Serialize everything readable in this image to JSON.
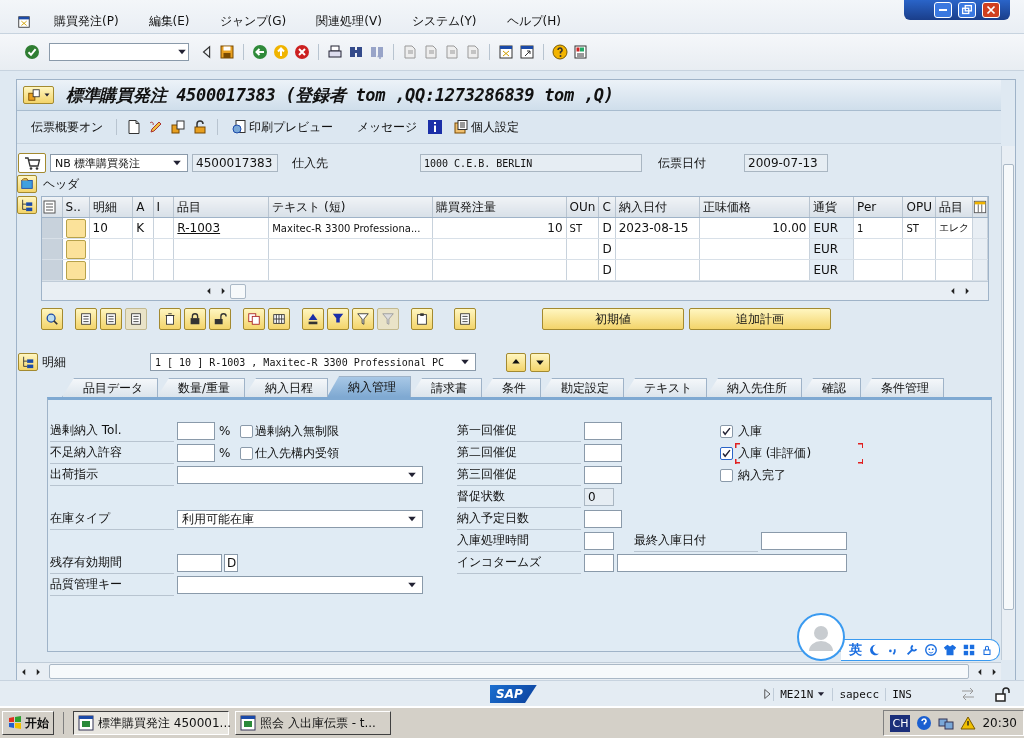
{
  "menu": [
    {
      "label": "購買発注(P)"
    },
    {
      "label": "編集(E)"
    },
    {
      "label": "ジャンプ(G)"
    },
    {
      "label": "関連処理(V)"
    },
    {
      "label": "システム(Y)"
    },
    {
      "label": "ヘルプ(H)"
    }
  ],
  "title": "標準購買発注 4500017383 (登録者 tom ,QQ:1273286839 tom ,Q)",
  "app_toolbar": {
    "overview": "伝票概要オン",
    "print_preview": "印刷プレビュー",
    "messages": "メッセージ",
    "personal_settings": "個人設定"
  },
  "header": {
    "doc_type": "NB 標準購買発注",
    "po_number": "4500017383",
    "vendor_label": "仕入先",
    "vendor": "1000 C.E.B. BERLIN",
    "date_label": "伝票日付",
    "date": "2009-07-13",
    "section_label": "ヘッダ"
  },
  "items_table": {
    "columns": [
      {
        "label": "S..",
        "kind": "status"
      },
      {
        "label": "明細",
        "kind": "text"
      },
      {
        "label": "A",
        "kind": "text"
      },
      {
        "label": "I",
        "kind": "text"
      },
      {
        "label": "品目",
        "kind": "link"
      },
      {
        "label": "テキスト (短)",
        "kind": "small"
      },
      {
        "label": "購買発注量",
        "kind": "number"
      },
      {
        "label": "OUn",
        "kind": "small"
      },
      {
        "label": "C",
        "kind": "text"
      },
      {
        "label": "納入日付",
        "kind": "text"
      },
      {
        "label": "正味価格",
        "kind": "number"
      },
      {
        "label": "通貨",
        "kind": "shaded"
      },
      {
        "label": "Per",
        "kind": "small"
      },
      {
        "label": "OPU",
        "kind": "small"
      },
      {
        "label": "品目",
        "kind": "small"
      }
    ],
    "rows": [
      {
        "cells": [
          null,
          "10",
          "K",
          null,
          "R-1003",
          "Maxitec-R 3300 Professiona...",
          "10",
          "ST",
          "D",
          "2023-08-15",
          "10.00",
          "EUR",
          "1",
          "ST",
          "エレク"
        ]
      },
      {
        "cells": [
          null,
          null,
          null,
          null,
          null,
          null,
          null,
          null,
          "D",
          null,
          null,
          "EUR",
          null,
          null,
          null
        ]
      },
      {
        "cells": [
          null,
          null,
          null,
          null,
          null,
          null,
          null,
          null,
          "D",
          null,
          null,
          "EUR",
          null,
          null,
          null
        ]
      }
    ]
  },
  "item_buttons": [
    "初期値",
    "追加計画"
  ],
  "item_detail": {
    "label": "明細",
    "selection": "1 [ 10 ] R-1003 , Maxitec-R 3300 Professional PC"
  },
  "tabs": [
    {
      "label": "品目データ",
      "selected": false
    },
    {
      "label": "数量/重量",
      "selected": false
    },
    {
      "label": "納入日程",
      "selected": false
    },
    {
      "label": "納入管理",
      "selected": true
    },
    {
      "label": "請求書",
      "selected": false
    },
    {
      "label": "条件",
      "selected": false
    },
    {
      "label": "勘定設定",
      "selected": false
    },
    {
      "label": "テキスト",
      "selected": false
    },
    {
      "label": "納入先住所",
      "selected": false
    },
    {
      "label": "確認",
      "selected": false
    },
    {
      "label": "条件管理",
      "selected": false
    }
  ],
  "delivery_form": {
    "left": [
      {
        "kind": "percent",
        "label": "過剰納入 Tol.",
        "unit": "%",
        "option": {
          "label": "過剰納入無制限",
          "checked": false
        }
      },
      {
        "kind": "percent",
        "label": "不足納入許容",
        "unit": "%",
        "option": {
          "label": "仕入先構内受領",
          "checked": false
        }
      },
      {
        "kind": "select",
        "label": "出荷指示"
      },
      {
        "kind": "blank"
      },
      {
        "kind": "select",
        "label": "在庫タイプ",
        "value": "利用可能在庫"
      },
      {
        "kind": "blank"
      },
      {
        "kind": "unit_input",
        "label": "残存有効期間",
        "unit": "D"
      },
      {
        "kind": "select",
        "label": "品質管理キー"
      }
    ],
    "middle": [
      {
        "kind": "input",
        "label": "第一回催促"
      },
      {
        "kind": "input",
        "label": "第二回催促"
      },
      {
        "kind": "input",
        "label": "第三回催促"
      },
      {
        "kind": "readonly",
        "label": "督促状数",
        "value": "0"
      },
      {
        "kind": "input",
        "label": "納入予定日数"
      },
      {
        "kind": "input_pair",
        "label": "入庫処理時間",
        "second_label": "最終入庫日付"
      },
      {
        "kind": "input_wide",
        "label": "インコタームズ"
      }
    ],
    "right": [
      {
        "label": "入庫",
        "checked": true,
        "focused": false
      },
      {
        "label": "入庫 (非評価)",
        "checked": true,
        "focused": true
      },
      {
        "label": "納入完了",
        "checked": false,
        "focused": false
      }
    ]
  },
  "status_bar": {
    "logo": "SAP",
    "transaction": "ME21N",
    "system": "sapecc",
    "mode": "INS"
  },
  "ime_bar": {
    "language": "英"
  },
  "taskbar": {
    "start": "开始",
    "tasks": [
      {
        "label": "標準購買発注 450001...",
        "selected": true
      },
      {
        "label": "照会 入出庫伝票 - t...",
        "selected": false
      }
    ],
    "input_language": "CH",
    "time": "20:30"
  }
}
